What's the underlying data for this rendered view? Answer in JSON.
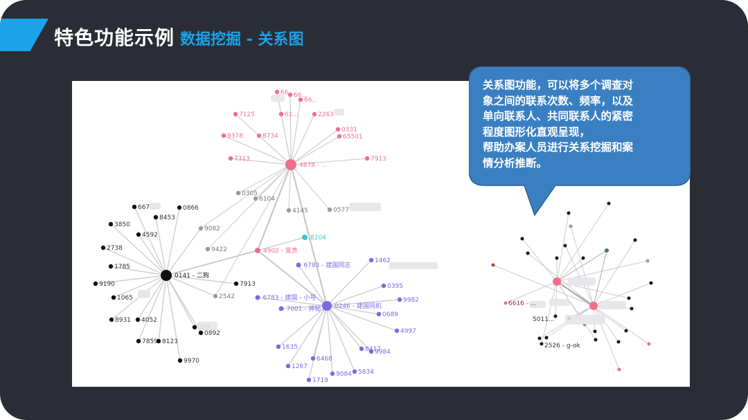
{
  "slide": {
    "title_main": "特色功能示例",
    "title_sub": "数据挖掘 - 关系图"
  },
  "callout": {
    "lines": [
      "关系图功能，可以将多个调查对",
      "象之间的联系次数、频率，以及",
      "单向联系人、共同联系人的紧密",
      "程度图形化直观呈现，",
      "帮助办案人员进行关系挖掘和案",
      "情分析推断。"
    ]
  },
  "colors": {
    "background": "#2b2d36",
    "accent": "#1aa3e8",
    "callout": "#3a7fc2",
    "pink": "#f06e8c",
    "purple": "#7b6ae0",
    "black": "#111111",
    "gray": "#9a9a9a"
  },
  "graph": {
    "nodes": {
      "pinkHub": {
        "label": "4878 - ...",
        "color": "pink"
      },
      "blackHub": {
        "label": "0141 - 二狗",
        "color": "black"
      },
      "purpleHub": {
        "label": "0246 - 建国同机",
        "color": "purple"
      },
      "redMid": {
        "label": "4902 - 富贵",
        "color": "pink"
      },
      "cyanMid": {
        "label": "8204",
        "color": "cyan"
      },
      "purpleA": {
        "label": "6783 - 建国同志",
        "color": "purple"
      },
      "purpleB": {
        "label": "6783 - 建国 - 小号",
        "color": "purple"
      },
      "purpleC": {
        "label": "7001 - 神秘...",
        "color": "purple"
      }
    },
    "pink_leaves": [
      "66...",
      "66...",
      "66...",
      "7125",
      "61...",
      "2263",
      "0331",
      "65501",
      "9378",
      "8734",
      "7313",
      "7913"
    ],
    "black_leaves": [
      "667...",
      "0866",
      "8453",
      "3850",
      "4592",
      "2738",
      "1785",
      "9190",
      "1065",
      "8931",
      "4052",
      "7859",
      "8123",
      "9970",
      "057...",
      "0892",
      "7913"
    ],
    "purple_leaves": [
      "1462",
      "0395",
      "9982",
      "0689",
      "4997",
      "9984",
      "8417",
      "5834",
      "9084",
      "1719",
      "6468",
      "1267",
      "1635"
    ],
    "gray_nodes": [
      "0305",
      "6104",
      "4145",
      "0577",
      "9082",
      "9422",
      "2542"
    ],
    "right_cluster_labels": [
      "2526 - g-ok",
      "5011...",
      "6616 - ..."
    ]
  }
}
